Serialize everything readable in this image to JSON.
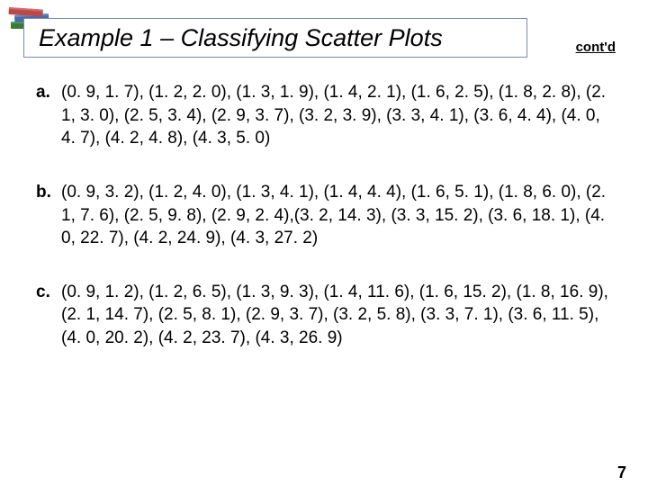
{
  "header": {
    "title": "Example 1 – Classifying Scatter Plots",
    "contd": "cont'd"
  },
  "items": [
    {
      "label": "a.",
      "text": "(0. 9, 1. 7), (1. 2, 2. 0), (1. 3, 1. 9), (1. 4, 2. 1), (1. 6, 2. 5), (1. 8, 2. 8), (2. 1, 3. 0), (2. 5, 3. 4), (2. 9, 3. 7), (3. 2, 3. 9), (3. 3, 4. 1), (3. 6, 4. 4), (4. 0, 4. 7), (4. 2, 4. 8), (4. 3, 5. 0)"
    },
    {
      "label": "b.",
      "text": "(0. 9, 3. 2), (1. 2, 4. 0), (1. 3, 4. 1), (1. 4, 4. 4), (1. 6, 5. 1), (1. 8, 6. 0), (2. 1, 7. 6), (2. 5, 9. 8), (2. 9, 2. 4),(3. 2, 14. 3), (3. 3, 15. 2), (3. 6, 18. 1), (4. 0, 22. 7), (4. 2, 24. 9), (4. 3, 27. 2)"
    },
    {
      "label": "c.",
      "text": "(0. 9, 1. 2), (1. 2, 6. 5), (1. 3, 9. 3), (1. 4, 11. 6), (1. 6, 15. 2), (1. 8, 16. 9), (2. 1, 14. 7), (2. 5, 8. 1), (2. 9, 3. 7), (3. 2, 5. 8), (3. 3, 7. 1), (3. 6, 11. 5), (4. 0, 20. 2), (4. 2, 23. 7), (4. 3, 26. 9)"
    }
  ],
  "page_number": "7"
}
